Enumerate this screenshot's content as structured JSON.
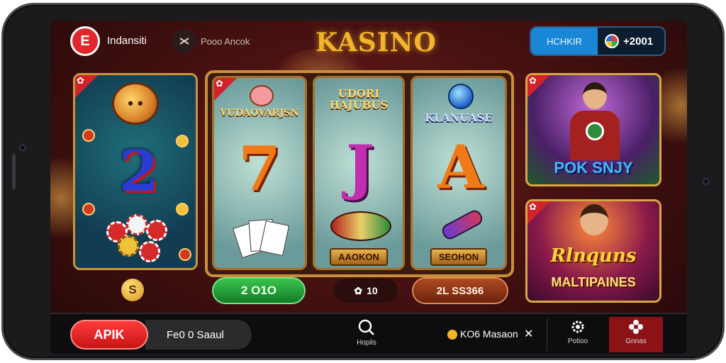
{
  "header": {
    "logo_letter": "E",
    "brand": "Indansiti",
    "sub_link": "Pooo Ancok",
    "title": "KASINO",
    "wallet_label": "HCHKIR",
    "wallet_amount": "+2001"
  },
  "cards": {
    "left": {
      "coin_text": "• •",
      "glyph": "2"
    },
    "reel1": {
      "title": "VUDAOVARJSN",
      "glyph": "7"
    },
    "reel2": {
      "title": "UDORI HAJUBUS",
      "glyph": "J",
      "label": "AAOKON"
    },
    "reel3": {
      "title": "KLANUASE",
      "glyph": "A",
      "label": "SEOHON"
    },
    "feature1": {
      "title": "POK SNJY"
    },
    "feature2": {
      "title_line1": "Rlnquns",
      "title_line2": "MALTIPAINES"
    }
  },
  "pills": {
    "small_coin": "S",
    "green": "2 O1O",
    "dark": "10",
    "brown": "2L SS366"
  },
  "bottom_bar": {
    "apk_label": "APIK",
    "search_text": "Fe0 0 Saaul",
    "nav_search_label": "Hopils",
    "gold_text": "KO6 Masaon",
    "nav_settings_label": "Potioo",
    "nav_profile_label": "Gnnas"
  },
  "colors": {
    "accent_gold": "#d8a73f",
    "brand_red": "#e3262b",
    "wallet_blue": "#1a86d6",
    "green_button": "#1e9a34"
  },
  "icons": [
    "menu-icon",
    "coin-icon",
    "search-icon",
    "gear-icon",
    "flower-icon",
    "close-icon",
    "chip-icon"
  ]
}
